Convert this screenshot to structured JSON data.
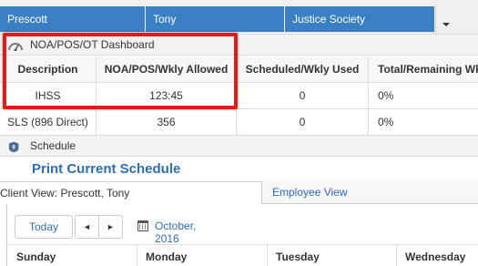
{
  "selected_row": {
    "cells": [
      "Prescott",
      "Tony",
      "Justice Society"
    ]
  },
  "dashboard": {
    "title": "NOA/POS/OT Dashboard",
    "icon": "gauge-icon",
    "columns": [
      "Description",
      "NOA/POS/Wkly Allowed",
      "Scheduled/Wkly Used",
      "Total/Remaining Wk"
    ],
    "rows": [
      [
        "IHSS",
        "123:45",
        "0",
        "0%"
      ],
      [
        "SLS (896 Direct)",
        "356",
        "0",
        "0%"
      ]
    ]
  },
  "schedule": {
    "title": "Schedule",
    "icon": "calendar-badge-icon",
    "print_link": "Print Current Schedule",
    "tabs": [
      "Client View: Prescott, Tony",
      "Employee View"
    ],
    "toolbar": {
      "today_label": "Today",
      "prev_label": "◄",
      "next_label": "►",
      "month": "October, 2016"
    },
    "days": [
      "Sunday",
      "Monday",
      "Tuesday",
      "Wednesday"
    ]
  },
  "colors": {
    "selection_blue": "#3a7fc4",
    "link_blue": "#2d6db4",
    "highlight_red": "#e01b1b"
  }
}
